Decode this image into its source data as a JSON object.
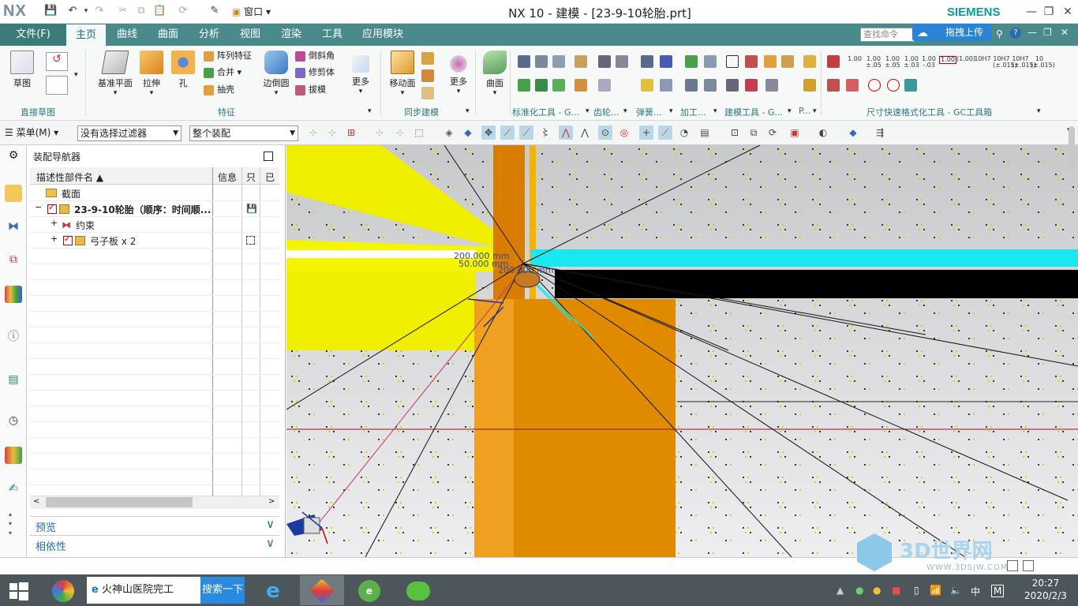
{
  "window": {
    "app_logo": "NX",
    "title": "NX 10 - 建模 - [23-9-10轮胎.prt]",
    "brand": "SIEMENS",
    "window_menu": "窗口"
  },
  "ribbon_tabs": {
    "file": "文件(F)",
    "items": [
      "主页",
      "曲线",
      "曲面",
      "分析",
      "视图",
      "渲染",
      "工具",
      "应用模块"
    ]
  },
  "search": {
    "placeholder": "查找命令"
  },
  "upload_button": "拖拽上传",
  "ribbon": {
    "sketch": "草图",
    "datum_plane": "基准平面",
    "extrude": "拉伸",
    "hole": "孔",
    "pattern": "阵列特征",
    "unite": "合并",
    "shell": "抽壳",
    "offset_face": "边倒圆",
    "chamfer": "倒斜角",
    "trim_body": "修剪体",
    "draft": "拔模",
    "more1": "更多",
    "move_face": "移动面",
    "more2": "更多",
    "surface": "曲面",
    "groups": {
      "direct_sketch": "直接草图",
      "feature": "特征",
      "sync_modeling": "同步建模",
      "standard_tools": "标准化工具 - G...",
      "gear": "齿轮...",
      "spring": "弹簧...",
      "machining": "加工...",
      "build_tools": "建模工具 - G...",
      "p": "P...",
      "dim_tools": "尺寸快速格式化工具 - GC工具箱"
    },
    "tolerances": [
      "1.00",
      "1.00 ±.05",
      "1.00 ±.05",
      "1.00 ±.03",
      "1.00 -.03",
      "1.00",
      "(1.00)",
      "10H7",
      "10H7 (±.015)",
      "10H7 (±.015)",
      "10 (±.015)"
    ]
  },
  "toolbar": {
    "menu": "菜单(M)",
    "filter": "没有选择过滤器",
    "scope": "整个装配"
  },
  "navigator": {
    "title": "装配导航器",
    "columns": {
      "name": "描述性部件名",
      "info": "信息",
      "readonly": "只",
      "modified": "已"
    },
    "rows": [
      {
        "label": "截面"
      },
      {
        "label": "23-9-10轮胎（顺序：时间顺..."
      },
      {
        "label": "约束"
      },
      {
        "label": "弓子板 x 2"
      }
    ],
    "preview": "预览",
    "dependencies": "相依性"
  },
  "viewport": {
    "dim1": "200.000 mm",
    "dim2": "50.000 mm",
    "dim3": "200.000 mm"
  },
  "taskbar": {
    "app1": "火神山医院完工",
    "search": "搜索一下",
    "time": "20:27",
    "date": "2020/2/3",
    "ime": "中",
    "m": "M"
  },
  "watermark": {
    "text": "3D世界网",
    "url": "WWW.3DSJW.COM"
  }
}
